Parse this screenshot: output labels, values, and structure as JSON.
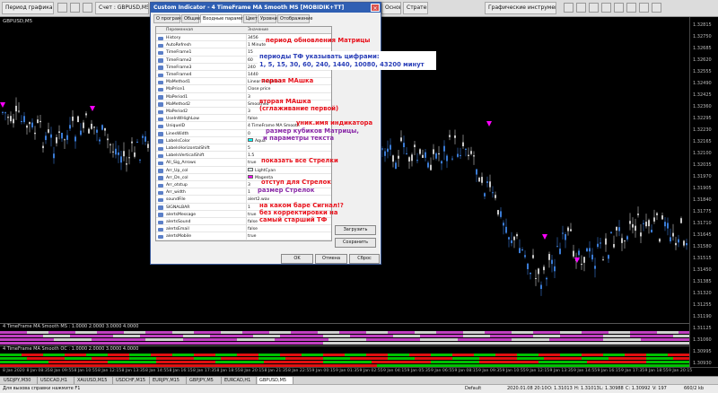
{
  "toolbar": {
    "items": [
      {
        "label": "Период графика"
      },
      {
        "label": "Счет : GBPUSD,M5"
      },
      {
        "label": "Основы"
      },
      {
        "label": "Стратег"
      },
      {
        "label": "Графические инструменты"
      }
    ]
  },
  "chart": {
    "symbol_label": "GBPUSD,M5",
    "price_ticks": [
      "1.32815",
      "1.32750",
      "1.32685",
      "1.32620",
      "1.32555",
      "1.32490",
      "1.32425",
      "1.32360",
      "1.32295",
      "1.32230",
      "1.32165",
      "1.32100",
      "1.32035",
      "1.31970",
      "1.31905",
      "1.31840",
      "1.31775",
      "1.31710",
      "1.31645",
      "1.31580",
      "1.31515",
      "1.31450",
      "1.31385",
      "1.31320",
      "1.31255",
      "1.31190",
      "1.31125",
      "1.31060",
      "1.30995",
      "1.30930"
    ],
    "current_price": "1.31013"
  },
  "panes": [
    {
      "label": "4 TimeFrame MA Smooth MS : 1.0000 2.0000 3.0000 4.0000"
    },
    {
      "label": "4 TimeFrame MA Smooth OC : 1.0000 2.0000 3.0000 4.0000"
    }
  ],
  "time_axis": [
    "8 Jan 2020",
    "8 Jan 08:35",
    "8 Jan 09:55",
    "8 Jan 10:55",
    "8 Jan 12:15",
    "8 Jan 13:35",
    "8 Jan 14:55",
    "8 Jan 16:15",
    "8 Jan 17:35",
    "8 Jan 18:55",
    "8 Jan 20:15",
    "8 Jan 21:35",
    "8 Jan 22:55",
    "9 Jan 00:15",
    "9 Jan 01:35",
    "9 Jan 02:55",
    "9 Jan 04:15",
    "9 Jan 05:35",
    "9 Jan 06:55",
    "9 Jan 08:15",
    "9 Jan 09:35",
    "9 Jan 10:55",
    "9 Jan 12:15",
    "9 Jan 13:35",
    "9 Jan 14:55",
    "9 Jan 16:15",
    "9 Jan 17:35",
    "9 Jan 18:55",
    "9 Jan 20:15"
  ],
  "tabs": [
    "USDJPY,M30",
    "USDCAD,H1",
    "XAUUSD,M15",
    "USDCHF,M15",
    "EURJPY,M15",
    "GBPJPY,M5",
    "EURCAD,H1",
    "GBPUSD,M5"
  ],
  "active_tab": 7,
  "status": {
    "help": "Для вызова справки нажмите F1",
    "profile": "Default",
    "datetime": "2020.01.08 20:10",
    "open": "O: 1.31013",
    "high": "H: 1.31013",
    "low": "L: 1.30988",
    "close": "C: 1.30992",
    "volume": "V: 197",
    "traffic": "660/2 kb"
  },
  "dialog": {
    "title": "Custom Indicator - 4 TimeFrame MA Smooth MS [MOBIDIK+TT]",
    "close": "×",
    "tabs": [
      "О программе",
      "Общие",
      "Входные параметры",
      "Цвета",
      "Уровни",
      "Отображение"
    ],
    "active_tab": 2,
    "col_name": "Переменная",
    "col_value": "Значение",
    "params": [
      {
        "name": "History",
        "value": "3456"
      },
      {
        "name": "AutoRefresh",
        "value": "1 Minute"
      },
      {
        "name": "TimeFrame1",
        "value": "15"
      },
      {
        "name": "TimeFrame2",
        "value": "60"
      },
      {
        "name": "TimeFrame3",
        "value": "240"
      },
      {
        "name": "TimeFrame4",
        "value": "1440"
      },
      {
        "name": "MaMethod1",
        "value": "Linear weighted"
      },
      {
        "name": "MaPrice1",
        "value": "Close price"
      },
      {
        "name": "MaPeriod1",
        "value": "3"
      },
      {
        "name": "MaMethod2",
        "value": "Smoothed"
      },
      {
        "name": "MaPeriod2",
        "value": "3"
      },
      {
        "name": "UseInWHighLow",
        "value": "false"
      },
      {
        "name": "UniqueID",
        "value": "4 TimeFrame MA Smooth"
      },
      {
        "name": "LinesWidth",
        "value": "0"
      },
      {
        "name": "LabelsColor",
        "value": "Aqua",
        "swatch": "#00ffff"
      },
      {
        "name": "LabelsHorizontalShift",
        "value": "5"
      },
      {
        "name": "LabelsVerticalShift",
        "value": "1.5"
      },
      {
        "name": "All_Sig_Arrows",
        "value": "true"
      },
      {
        "name": "Arr_Up_col",
        "value": "LightCyan",
        "swatch": "#e0ffff"
      },
      {
        "name": "Arr_Dn_col",
        "value": "Magenta",
        "swatch": "#ff00ff"
      },
      {
        "name": "Arr_otstup",
        "value": "3"
      },
      {
        "name": "Arr_width",
        "value": "1"
      },
      {
        "name": "soundFile",
        "value": "alert2.wav"
      },
      {
        "name": "SIGNALBAR",
        "value": "1"
      },
      {
        "name": "alertsMessage",
        "value": "true"
      },
      {
        "name": "alertsSound",
        "value": "false"
      },
      {
        "name": "alertsEmail",
        "value": "false"
      },
      {
        "name": "alertsMobile",
        "value": "true"
      }
    ],
    "load_button": "Загрузить",
    "save_button": "Сохранить",
    "ok_button": "OK",
    "cancel_button": "Отмена",
    "reset_button": "Сброс"
  },
  "annotations": {
    "refresh": "период обновления Матрицы",
    "tf_1": "периоды ТФ указывать цифрами:",
    "tf_2": "1, 5, 15, 30, 60, 240, 1440, 10080, 43200 минут",
    "ma1": "первая МАшка",
    "ma2_1": "вторая МАшка",
    "ma2_2": "(сглаживание первой)",
    "uid": "уник.имя индикатора",
    "size_1": "размер кубиков Матрицы,",
    "size_2": "и параметры текста",
    "arrows": "показать все Стрелки",
    "otstup": "отступ для Стрелок",
    "arr_size": "размер Стрелок",
    "signal_1": "на каком баре Сигнал!?",
    "signal_2": "без корректировки на",
    "signal_3": "самый старший ТФ"
  },
  "colors": {
    "bull": "#3a7bd5",
    "bear": "#c8c8c8",
    "matrix_up": "#00c000",
    "matrix_dn": "#e01010",
    "matrix_purple": "#c040c0",
    "arrow": "#ff00ff"
  }
}
